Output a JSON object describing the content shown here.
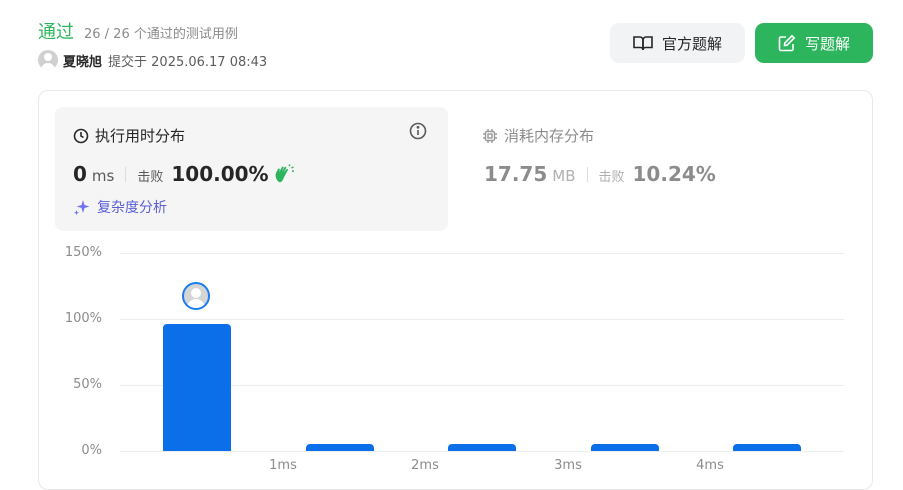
{
  "status": {
    "title": "通过",
    "cases": "26 / 26 个通过的测试用例"
  },
  "submission": {
    "user": "夏晓旭",
    "submitted_text": "提交于 2025.06.17 08:43"
  },
  "buttons": {
    "official": "官方题解",
    "write": "写题解"
  },
  "runtime": {
    "title": "执行用时分布",
    "value": "0",
    "unit": "ms",
    "beats_label": "击败",
    "beats_value": "100.00%",
    "complexity_label": "复杂度分析"
  },
  "memory": {
    "title": "消耗内存分布",
    "value": "17.75",
    "unit": "MB",
    "beats_label": "击败",
    "beats_value": "10.24%"
  },
  "chart_data": {
    "type": "bar",
    "categories": [
      "",
      "1ms",
      "2ms",
      "3ms",
      "4ms"
    ],
    "values": [
      96,
      5,
      5,
      5,
      5
    ],
    "ylim": [
      0,
      150
    ],
    "yticks": [
      "150%",
      "100%",
      "50%",
      "0%"
    ],
    "grid": true,
    "highlight_index": 0
  },
  "colors": {
    "accent_green": "#2db55d",
    "bar_blue": "#0a6fe8",
    "complexity_purple": "#5b5fd6"
  }
}
